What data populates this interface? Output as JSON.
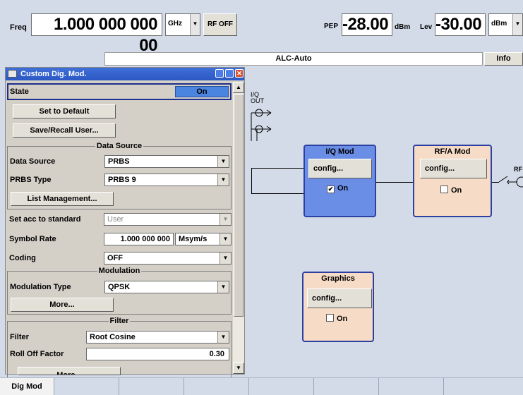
{
  "topbar": {
    "freq_label": "Freq",
    "freq_value": "1.000 000 000 00",
    "freq_unit": "GHz",
    "rf_button": "RF OFF",
    "pep_label": "PEP",
    "pep_value": "-28.00",
    "pep_unit": "dBm",
    "lev_label": "Lev",
    "lev_value": "-30.00",
    "lev_unit": "dBm"
  },
  "status": {
    "alc": "ALC-Auto",
    "info_button": "Info"
  },
  "diagram": {
    "iq_out_label": "I/Q\nOUT",
    "iq_mod": {
      "title": "I/Q Mod",
      "config": "config...",
      "on_label": "On",
      "checked": true,
      "color": "#6a8ee6"
    },
    "rfa_mod": {
      "title": "RF/A Mod",
      "config": "config...",
      "on_label": "On",
      "checked": false,
      "color": "#f6dcc7"
    },
    "graphics": {
      "title": "Graphics",
      "config": "config...",
      "on_label": "On",
      "checked": false,
      "color": "#f6dcc7"
    },
    "rf_label": "RF"
  },
  "dialog": {
    "title": "Custom Dig. Mod.",
    "state_label": "State",
    "state_value": "On",
    "set_default": "Set to Default",
    "save_recall": "Save/Recall User...",
    "data_source_group": "Data Source",
    "data_source_label": "Data Source",
    "data_source_value": "PRBS",
    "prbs_type_label": "PRBS Type",
    "prbs_type_value": "PRBS 9",
    "list_management": "List Management...",
    "set_acc_label": "Set acc to standard",
    "set_acc_value": "User",
    "symbol_rate_label": "Symbol Rate",
    "symbol_rate_value": "1.000 000 000",
    "symbol_rate_unit": "Msym/s",
    "coding_label": "Coding",
    "coding_value": "OFF",
    "modulation_group": "Modulation",
    "modulation_type_label": "Modulation Type",
    "modulation_type_value": "QPSK",
    "more_button": "More...",
    "filter_group": "Filter",
    "filter_label": "Filter",
    "filter_value": "Root Cosine",
    "rolloff_label": "Roll Off Factor",
    "rolloff_value": "0.30",
    "more_button_2": "More..."
  },
  "tabs": [
    "Dig Mod",
    "",
    "",
    "",
    "",
    "",
    "",
    ""
  ]
}
